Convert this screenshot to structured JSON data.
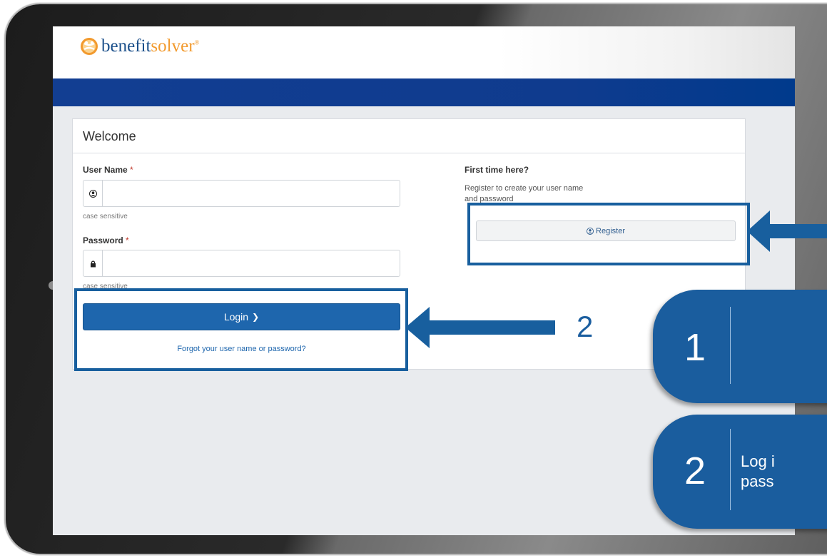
{
  "brand": {
    "logo_part1": "benefit",
    "logo_part2": "solver",
    "logo_reg": "®"
  },
  "login_card": {
    "title": "Welcome",
    "username_label": "User Name",
    "password_label": "Password",
    "required_mark": "*",
    "username_value": "",
    "password_value": "",
    "username_hint": "case sensitive",
    "password_hint": "case sensitive",
    "login_button": "Login",
    "login_chevron": "❯",
    "forgot_link": "Forgot your user name or password?"
  },
  "register_panel": {
    "heading": "First time here?",
    "description": "Register to create your user name and password",
    "register_button": "Register"
  },
  "annotations": {
    "callout_2_number": "2",
    "step1": {
      "number": "1",
      "text": ""
    },
    "step2": {
      "number": "2",
      "text": "Log i\npass"
    }
  },
  "colors": {
    "nav_bar": "#123e92",
    "primary_button": "#1e66ad",
    "annotation_blue": "#185f9e",
    "logo_blue": "#1a4f8a",
    "logo_orange": "#f29a2e"
  }
}
